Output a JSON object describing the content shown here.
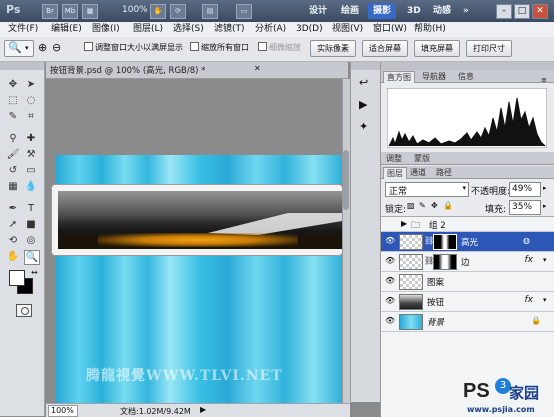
{
  "titlebar": {
    "app_logo": "Ps",
    "zoom": "100%",
    "workspaces": [
      "设计",
      "绘画",
      "摄影",
      "3D",
      "动感"
    ],
    "active_workspace": "摄影",
    "more": "»"
  },
  "menu": [
    "文件(F)",
    "编辑(E)",
    "图像(I)",
    "图层(L)",
    "选择(S)",
    "滤镜(T)",
    "分析(A)",
    "3D(D)",
    "视图(V)",
    "窗口(W)",
    "帮助(H)"
  ],
  "options": {
    "resize_windows": "调整窗口大小以满屏显示",
    "zoom_all": "缩放所有窗口",
    "scrubby_zoom": "细微缩放",
    "actual_pixels": "实际像素",
    "fit_screen": "适合屏幕",
    "fill_screen": "填充屏幕",
    "print_size": "打印尺寸"
  },
  "document": {
    "tab_title": "按钮背景.psd @ 100% (高光, RGB/8) *",
    "zoom_status": "100%",
    "doc_size": "文档:1.02M/9.42M",
    "watermark": "腾龍視覺WWW.TLVI.NET"
  },
  "histogram_panel": {
    "tabs": [
      "直方图",
      "导航器",
      "信息"
    ]
  },
  "adjust_panel": {
    "tabs": [
      "调整",
      "蒙版"
    ]
  },
  "layers_panel": {
    "tabs": [
      "图层",
      "通道",
      "路径"
    ],
    "blend_mode": "正常",
    "opacity_label": "不透明度:",
    "opacity": "49%",
    "lock_label": "锁定:",
    "fill_label": "填充:",
    "fill": "35%",
    "layers": [
      {
        "name": "组 2",
        "type": "group",
        "fx": ""
      },
      {
        "name": "高光",
        "type": "masked",
        "fx": "",
        "selected": true
      },
      {
        "name": "边",
        "type": "masked",
        "fx": "fx"
      },
      {
        "name": "图案",
        "type": "normal",
        "fx": ""
      },
      {
        "name": "按钮",
        "type": "normal",
        "fx": "fx"
      },
      {
        "name": "背景",
        "type": "background",
        "fx": ""
      }
    ]
  },
  "site_logo": {
    "brand": "PS",
    "suffix": "家园",
    "url": "www.psjia.com"
  },
  "colors": {
    "selection": "#2d57b7",
    "titlebar": "#3b4a60",
    "canvas_cyan": "#3fc4e6",
    "button_orange": "#e79c12"
  }
}
